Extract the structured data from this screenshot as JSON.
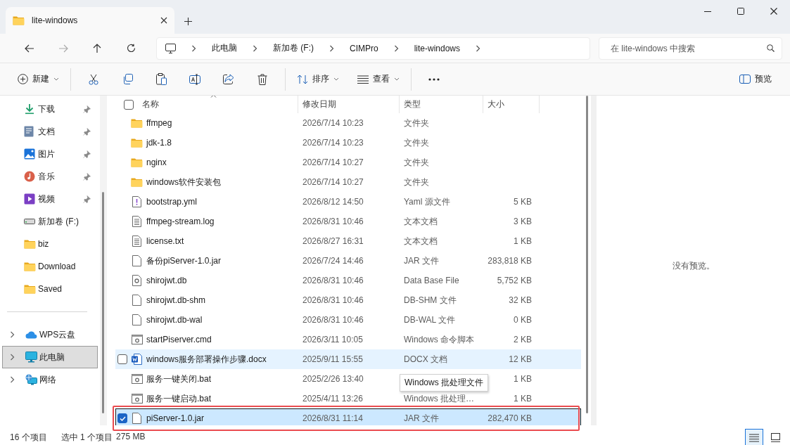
{
  "window": {
    "tab_title": "lite-windows"
  },
  "breadcrumb": [
    "此电脑",
    "新加卷 (F:)",
    "CIMPro",
    "lite-windows"
  ],
  "search": {
    "placeholder": "在 lite-windows 中搜索"
  },
  "toolbar": {
    "new_label": "新建",
    "sort_label": "排序",
    "view_label": "查看",
    "preview_label": "预览"
  },
  "sidebar": {
    "items": [
      {
        "kind": "download",
        "label": "下载",
        "pinned": true,
        "selected": false
      },
      {
        "kind": "documents",
        "label": "文档",
        "pinned": true,
        "selected": false
      },
      {
        "kind": "pictures",
        "label": "图片",
        "pinned": true,
        "selected": false
      },
      {
        "kind": "music",
        "label": "音乐",
        "pinned": true,
        "selected": false
      },
      {
        "kind": "videos",
        "label": "视频",
        "pinned": true,
        "selected": false
      },
      {
        "kind": "drive",
        "label": "新加卷 (F:)",
        "pinned": false,
        "selected": false
      },
      {
        "kind": "folder",
        "label": "biz",
        "pinned": false,
        "selected": false
      },
      {
        "kind": "folder",
        "label": "Download",
        "pinned": false,
        "selected": false
      },
      {
        "kind": "folder",
        "label": "Saved",
        "pinned": false,
        "selected": false
      }
    ],
    "locations": [
      {
        "kind": "cloud",
        "label": "WPS云盘",
        "expanded": false,
        "selected": false
      },
      {
        "kind": "pc",
        "label": "此电脑",
        "expanded": false,
        "selected": true
      },
      {
        "kind": "network",
        "label": "网络",
        "expanded": false,
        "selected": false
      }
    ]
  },
  "table": {
    "select_all": {
      "checked": false
    },
    "columns": [
      "名称",
      "修改日期",
      "类型",
      "大小"
    ],
    "rows": [
      {
        "kind": "folder",
        "name": "ffmpeg",
        "date": "2026/7/14 10:23",
        "type": "文件夹",
        "selected": false,
        "hovered": false
      },
      {
        "kind": "folder",
        "name": "jdk-1.8",
        "date": "2026/7/14 10:23",
        "type": "文件夹",
        "selected": false,
        "hovered": false
      },
      {
        "kind": "folder",
        "name": "nginx",
        "date": "2026/7/14 10:27",
        "type": "文件夹",
        "selected": false,
        "hovered": false
      },
      {
        "kind": "folder",
        "name": "windows软件安装包",
        "date": "2026/7/14 10:27",
        "type": "文件夹",
        "selected": false,
        "hovered": false
      },
      {
        "kind": "yaml",
        "name": "bootstrap.yml",
        "date": "2026/8/12 14:50",
        "type": "Yaml 源文件",
        "size": "5 KB",
        "selected": false,
        "hovered": false
      },
      {
        "kind": "text",
        "name": "ffmpeg-stream.log",
        "date": "2026/8/31 10:46",
        "type": "文本文档",
        "size": "3 KB",
        "selected": false,
        "hovered": false
      },
      {
        "kind": "text",
        "name": "license.txt",
        "date": "2026/8/27 16:31",
        "type": "文本文档",
        "size": "1 KB",
        "selected": false,
        "hovered": false
      },
      {
        "kind": "file",
        "name": "备份piServer-1.0.jar",
        "date": "2026/7/24 14:46",
        "type": "JAR 文件",
        "size": "283,818 KB",
        "selected": false,
        "hovered": false
      },
      {
        "kind": "system",
        "name": "shirojwt.db",
        "date": "2026/8/31 10:46",
        "type": "Data Base File",
        "size": "5,752 KB",
        "selected": false,
        "hovered": false
      },
      {
        "kind": "file",
        "name": "shirojwt.db-shm",
        "date": "2026/8/31 10:46",
        "type": "DB-SHM 文件",
        "size": "32 KB",
        "selected": false,
        "hovered": false
      },
      {
        "kind": "file",
        "name": "shirojwt.db-wal",
        "date": "2026/8/31 10:46",
        "type": "DB-WAL 文件",
        "size": "0 KB",
        "selected": false,
        "hovered": false
      },
      {
        "kind": "script",
        "name": "startPiserver.cmd",
        "date": "2026/3/11 10:05",
        "type": "Windows 命令脚本",
        "size": "2 KB",
        "selected": false,
        "hovered": false
      },
      {
        "kind": "word",
        "name": "windows服务部署操作步骤.docx",
        "date": "2025/9/11 15:55",
        "type": "DOCX 文档",
        "size": "12 KB",
        "selected": false,
        "hovered": true
      },
      {
        "kind": "script",
        "name": "服务一键关闭.bat",
        "date": "2025/2/26 13:40",
        "tooltip": "Windows 批处理文件",
        "size": "1 KB",
        "selected": false,
        "hovered": false
      },
      {
        "kind": "script",
        "name": "服务一键启动.bat",
        "date": "2025/4/11 13:26",
        "type": "Windows 批处理…",
        "size": "1 KB",
        "selected": false,
        "hovered": false
      },
      {
        "kind": "file",
        "name": "piServer-1.0.jar",
        "date": "2026/8/31 11:14",
        "type": "JAR 文件",
        "size": "282,470 KB",
        "selected": true,
        "hovered": false,
        "highlighted": true
      }
    ]
  },
  "preview": {
    "message": "没有预览。"
  },
  "status_bar": {
    "count": "16 个项目",
    "selection": "选中 1 个项目",
    "selection_size": "275 MB",
    "views": [
      {
        "kind": "details",
        "selected": true
      },
      {
        "kind": "tiles",
        "selected": false
      }
    ]
  }
}
